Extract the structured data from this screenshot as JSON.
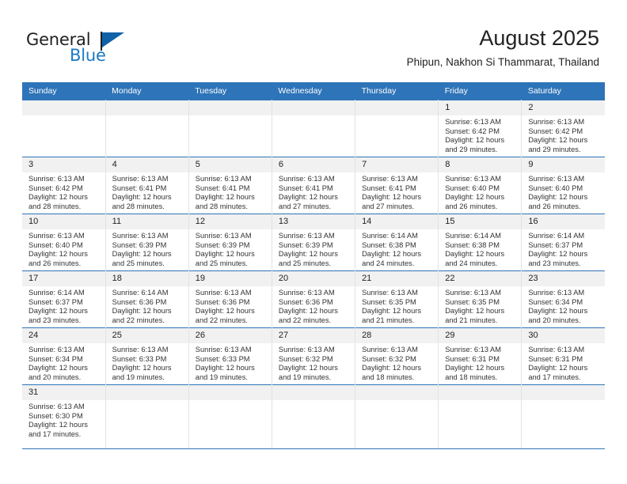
{
  "brand": {
    "name_top": "General",
    "name_bottom": "Blue",
    "accent_color": "#1b7ac2",
    "flag_color": "#1062a8"
  },
  "header": {
    "title": "August 2025",
    "subtitle": "Phipun, Nakhon Si Thammarat, Thailand"
  },
  "calendar": {
    "header_bg": "#2e74b8",
    "daynum_bg": "#f1f1f1",
    "weekdays": [
      "Sunday",
      "Monday",
      "Tuesday",
      "Wednesday",
      "Thursday",
      "Friday",
      "Saturday"
    ],
    "weeks": [
      [
        {
          "day": "",
          "lines": []
        },
        {
          "day": "",
          "lines": []
        },
        {
          "day": "",
          "lines": []
        },
        {
          "day": "",
          "lines": []
        },
        {
          "day": "",
          "lines": []
        },
        {
          "day": "1",
          "lines": [
            "Sunrise: 6:13 AM",
            "Sunset: 6:42 PM",
            "Daylight: 12 hours",
            "and 29 minutes."
          ]
        },
        {
          "day": "2",
          "lines": [
            "Sunrise: 6:13 AM",
            "Sunset: 6:42 PM",
            "Daylight: 12 hours",
            "and 29 minutes."
          ]
        }
      ],
      [
        {
          "day": "3",
          "lines": [
            "Sunrise: 6:13 AM",
            "Sunset: 6:42 PM",
            "Daylight: 12 hours",
            "and 28 minutes."
          ]
        },
        {
          "day": "4",
          "lines": [
            "Sunrise: 6:13 AM",
            "Sunset: 6:41 PM",
            "Daylight: 12 hours",
            "and 28 minutes."
          ]
        },
        {
          "day": "5",
          "lines": [
            "Sunrise: 6:13 AM",
            "Sunset: 6:41 PM",
            "Daylight: 12 hours",
            "and 28 minutes."
          ]
        },
        {
          "day": "6",
          "lines": [
            "Sunrise: 6:13 AM",
            "Sunset: 6:41 PM",
            "Daylight: 12 hours",
            "and 27 minutes."
          ]
        },
        {
          "day": "7",
          "lines": [
            "Sunrise: 6:13 AM",
            "Sunset: 6:41 PM",
            "Daylight: 12 hours",
            "and 27 minutes."
          ]
        },
        {
          "day": "8",
          "lines": [
            "Sunrise: 6:13 AM",
            "Sunset: 6:40 PM",
            "Daylight: 12 hours",
            "and 26 minutes."
          ]
        },
        {
          "day": "9",
          "lines": [
            "Sunrise: 6:13 AM",
            "Sunset: 6:40 PM",
            "Daylight: 12 hours",
            "and 26 minutes."
          ]
        }
      ],
      [
        {
          "day": "10",
          "lines": [
            "Sunrise: 6:13 AM",
            "Sunset: 6:40 PM",
            "Daylight: 12 hours",
            "and 26 minutes."
          ]
        },
        {
          "day": "11",
          "lines": [
            "Sunrise: 6:13 AM",
            "Sunset: 6:39 PM",
            "Daylight: 12 hours",
            "and 25 minutes."
          ]
        },
        {
          "day": "12",
          "lines": [
            "Sunrise: 6:13 AM",
            "Sunset: 6:39 PM",
            "Daylight: 12 hours",
            "and 25 minutes."
          ]
        },
        {
          "day": "13",
          "lines": [
            "Sunrise: 6:13 AM",
            "Sunset: 6:39 PM",
            "Daylight: 12 hours",
            "and 25 minutes."
          ]
        },
        {
          "day": "14",
          "lines": [
            "Sunrise: 6:14 AM",
            "Sunset: 6:38 PM",
            "Daylight: 12 hours",
            "and 24 minutes."
          ]
        },
        {
          "day": "15",
          "lines": [
            "Sunrise: 6:14 AM",
            "Sunset: 6:38 PM",
            "Daylight: 12 hours",
            "and 24 minutes."
          ]
        },
        {
          "day": "16",
          "lines": [
            "Sunrise: 6:14 AM",
            "Sunset: 6:37 PM",
            "Daylight: 12 hours",
            "and 23 minutes."
          ]
        }
      ],
      [
        {
          "day": "17",
          "lines": [
            "Sunrise: 6:14 AM",
            "Sunset: 6:37 PM",
            "Daylight: 12 hours",
            "and 23 minutes."
          ]
        },
        {
          "day": "18",
          "lines": [
            "Sunrise: 6:14 AM",
            "Sunset: 6:36 PM",
            "Daylight: 12 hours",
            "and 22 minutes."
          ]
        },
        {
          "day": "19",
          "lines": [
            "Sunrise: 6:13 AM",
            "Sunset: 6:36 PM",
            "Daylight: 12 hours",
            "and 22 minutes."
          ]
        },
        {
          "day": "20",
          "lines": [
            "Sunrise: 6:13 AM",
            "Sunset: 6:36 PM",
            "Daylight: 12 hours",
            "and 22 minutes."
          ]
        },
        {
          "day": "21",
          "lines": [
            "Sunrise: 6:13 AM",
            "Sunset: 6:35 PM",
            "Daylight: 12 hours",
            "and 21 minutes."
          ]
        },
        {
          "day": "22",
          "lines": [
            "Sunrise: 6:13 AM",
            "Sunset: 6:35 PM",
            "Daylight: 12 hours",
            "and 21 minutes."
          ]
        },
        {
          "day": "23",
          "lines": [
            "Sunrise: 6:13 AM",
            "Sunset: 6:34 PM",
            "Daylight: 12 hours",
            "and 20 minutes."
          ]
        }
      ],
      [
        {
          "day": "24",
          "lines": [
            "Sunrise: 6:13 AM",
            "Sunset: 6:34 PM",
            "Daylight: 12 hours",
            "and 20 minutes."
          ]
        },
        {
          "day": "25",
          "lines": [
            "Sunrise: 6:13 AM",
            "Sunset: 6:33 PM",
            "Daylight: 12 hours",
            "and 19 minutes."
          ]
        },
        {
          "day": "26",
          "lines": [
            "Sunrise: 6:13 AM",
            "Sunset: 6:33 PM",
            "Daylight: 12 hours",
            "and 19 minutes."
          ]
        },
        {
          "day": "27",
          "lines": [
            "Sunrise: 6:13 AM",
            "Sunset: 6:32 PM",
            "Daylight: 12 hours",
            "and 19 minutes."
          ]
        },
        {
          "day": "28",
          "lines": [
            "Sunrise: 6:13 AM",
            "Sunset: 6:32 PM",
            "Daylight: 12 hours",
            "and 18 minutes."
          ]
        },
        {
          "day": "29",
          "lines": [
            "Sunrise: 6:13 AM",
            "Sunset: 6:31 PM",
            "Daylight: 12 hours",
            "and 18 minutes."
          ]
        },
        {
          "day": "30",
          "lines": [
            "Sunrise: 6:13 AM",
            "Sunset: 6:31 PM",
            "Daylight: 12 hours",
            "and 17 minutes."
          ]
        }
      ],
      [
        {
          "day": "31",
          "lines": [
            "Sunrise: 6:13 AM",
            "Sunset: 6:30 PM",
            "Daylight: 12 hours",
            "and 17 minutes."
          ]
        },
        {
          "day": "",
          "lines": []
        },
        {
          "day": "",
          "lines": []
        },
        {
          "day": "",
          "lines": []
        },
        {
          "day": "",
          "lines": []
        },
        {
          "day": "",
          "lines": []
        },
        {
          "day": "",
          "lines": []
        }
      ]
    ]
  }
}
